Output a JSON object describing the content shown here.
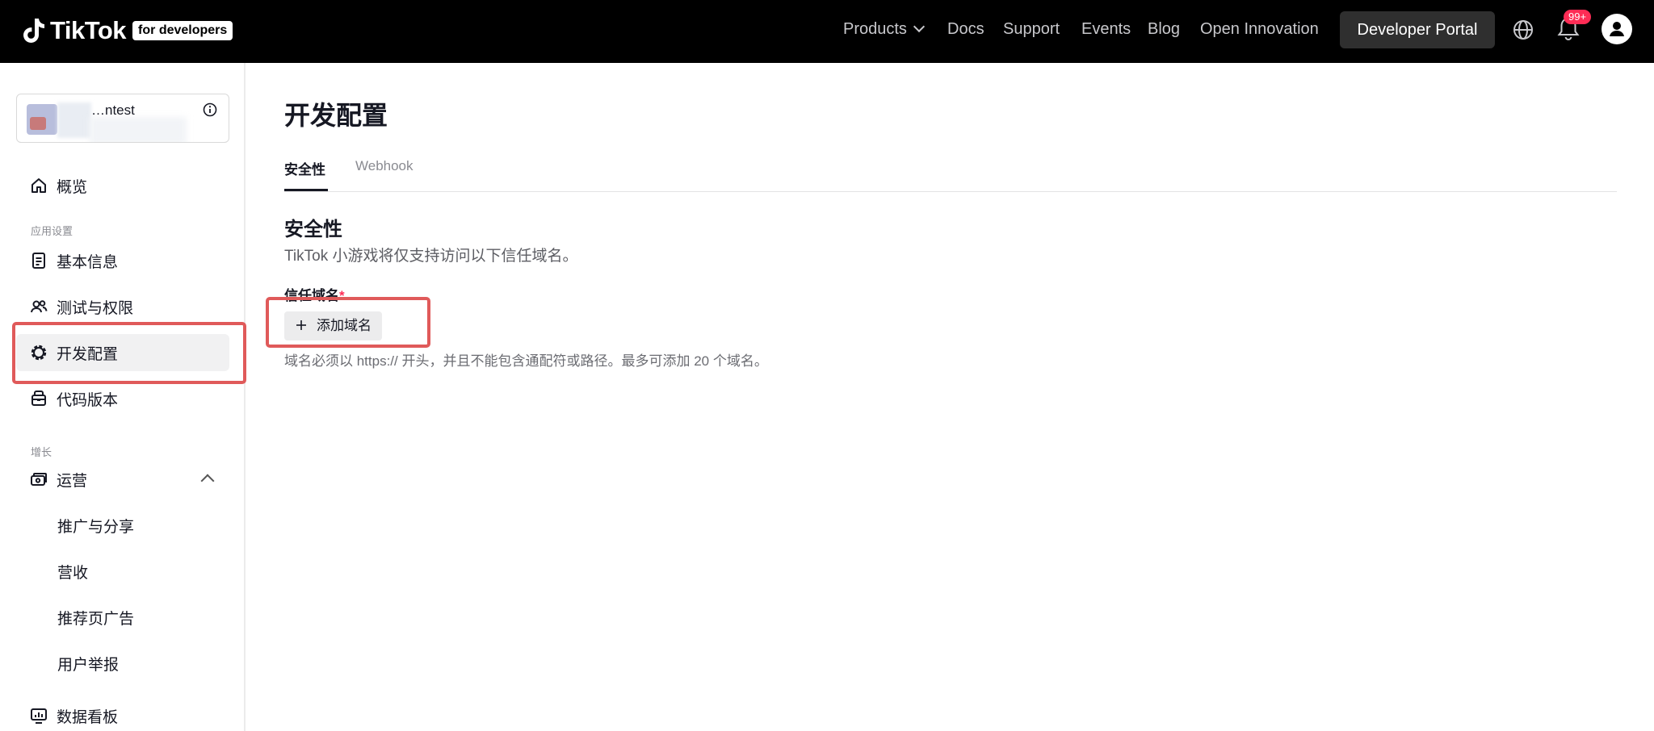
{
  "topnav": {
    "logo_text": "TikTok",
    "logo_badge": "for developers",
    "items": {
      "products": "Products",
      "docs": "Docs",
      "support": "Support",
      "events": "Events",
      "blog": "Blog",
      "open_innovation": "Open Innovation"
    },
    "portal_button": "Developer Portal",
    "notification_badge": "99+",
    "icons": [
      "tiktok-logo-icon",
      "chevron-down-icon",
      "globe-icon",
      "bell-icon",
      "user-avatar-icon"
    ]
  },
  "sidebar": {
    "app_name": "…ntest",
    "overview": "概览",
    "group_app_settings": "应用设置",
    "basic_info": "基本信息",
    "testing_permissions": "测试与权限",
    "dev_config": "开发配置",
    "code_version": "代码版本",
    "group_growth": "增长",
    "operations": "运营",
    "promotion_share": "推广与分享",
    "revenue": "营收",
    "feed_ads": "推荐页广告",
    "user_reports": "用户举报",
    "dashboard": "数据看板"
  },
  "main": {
    "title": "开发配置",
    "tabs": [
      "安全性",
      "Webhook"
    ],
    "active_tab": "安全性",
    "section_title": "安全性",
    "section_desc": "TikTok 小游戏将仅支持访问以下信任域名。",
    "field_label": "信任域名",
    "required_mark": "*",
    "add_domain_button": "添加域名",
    "help_text": "域名必须以 https:// 开头，并且不能包含通配符或路径。最多可添加 20 个域名。"
  },
  "colors": {
    "topbar_bg": "#000000",
    "highlight_box": "#e05a5a",
    "badge": "#fe2c55",
    "active_item_bg": "#f1f1f2"
  }
}
